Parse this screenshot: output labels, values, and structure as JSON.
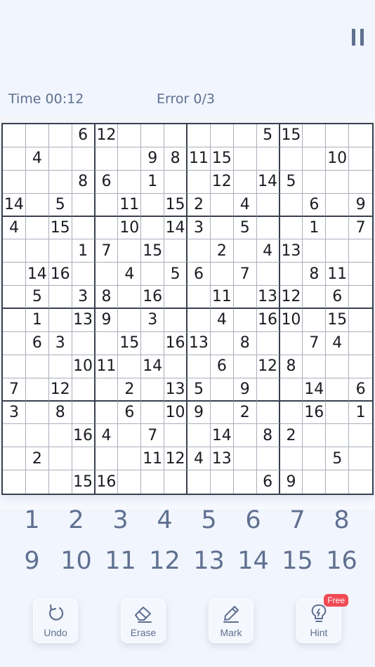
{
  "status": {
    "time_label": "Time",
    "time_value": "00:12",
    "error_label": "Error",
    "error_value": "0/3"
  },
  "board": {
    "size": 16,
    "box": 4,
    "grid": [
      [
        "",
        "",
        "",
        "6",
        "12",
        "",
        "",
        "",
        "",
        "",
        "",
        "5",
        "15",
        "",
        "",
        ""
      ],
      [
        "",
        "4",
        "",
        "",
        "",
        "",
        "9",
        "8",
        "11",
        "15",
        "",
        "",
        "",
        "",
        "10",
        ""
      ],
      [
        "",
        "",
        "",
        "8",
        "6",
        "",
        "1",
        "",
        "",
        "12",
        "",
        "14",
        "5",
        "",
        "",
        ""
      ],
      [
        "14",
        "",
        "5",
        "",
        "",
        "11",
        "",
        "15",
        "2",
        "",
        "4",
        "",
        "",
        "6",
        "",
        "9"
      ],
      [
        "4",
        "",
        "15",
        "",
        "",
        "10",
        "",
        "14",
        "3",
        "",
        "5",
        "",
        "",
        "1",
        "",
        "7"
      ],
      [
        "",
        "",
        "",
        "1",
        "7",
        "",
        "15",
        "",
        "",
        "2",
        "",
        "4",
        "13",
        "",
        "",
        ""
      ],
      [
        "",
        "14",
        "16",
        "",
        "",
        "4",
        "",
        "5",
        "6",
        "",
        "7",
        "",
        "",
        "8",
        "11",
        ""
      ],
      [
        "",
        "5",
        "",
        "3",
        "8",
        "",
        "16",
        "",
        "",
        "11",
        "",
        "13",
        "12",
        "",
        "6",
        ""
      ],
      [
        "",
        "1",
        "",
        "13",
        "9",
        "",
        "3",
        "",
        "",
        "4",
        "",
        "16",
        "10",
        "",
        "15",
        ""
      ],
      [
        "",
        "6",
        "3",
        "",
        "",
        "15",
        "",
        "16",
        "13",
        "",
        "8",
        "",
        "",
        "7",
        "4",
        ""
      ],
      [
        "",
        "",
        "",
        "10",
        "11",
        "",
        "14",
        "",
        "",
        "6",
        "",
        "12",
        "8",
        "",
        "",
        ""
      ],
      [
        "7",
        "",
        "12",
        "",
        "",
        "2",
        "",
        "13",
        "5",
        "",
        "9",
        "",
        "",
        "14",
        "",
        "6"
      ],
      [
        "3",
        "",
        "8",
        "",
        "",
        "6",
        "",
        "10",
        "9",
        "",
        "2",
        "",
        "",
        "16",
        "",
        "1"
      ],
      [
        "",
        "",
        "",
        "16",
        "4",
        "",
        "7",
        "",
        "",
        "14",
        "",
        "8",
        "2",
        "",
        "",
        ""
      ],
      [
        "",
        "2",
        "",
        "",
        "",
        "",
        "11",
        "12",
        "4",
        "13",
        "",
        "",
        "",
        "",
        "5",
        ""
      ],
      [
        "",
        "",
        "",
        "15",
        "16",
        "",
        "",
        "",
        "",
        "",
        "",
        "6",
        "9",
        "",
        "",
        ""
      ]
    ]
  },
  "numpad": [
    "1",
    "2",
    "3",
    "4",
    "5",
    "6",
    "7",
    "8",
    "9",
    "10",
    "11",
    "12",
    "13",
    "14",
    "15",
    "16"
  ],
  "tools": {
    "undo": "Undo",
    "erase": "Erase",
    "mark": "Mark",
    "hint": "Hint",
    "hint_badge": "Free"
  },
  "icons": {
    "pause": "pause-icon",
    "undo": "undo-icon",
    "erase": "eraser-icon",
    "mark": "pencil-icon",
    "hint": "lightbulb-icon"
  },
  "colors": {
    "background": "#f1f5fd",
    "accent": "#5f7090",
    "badge": "#f04b55",
    "grid_thick": "#39404d",
    "grid_thin": "#a9aebb"
  }
}
